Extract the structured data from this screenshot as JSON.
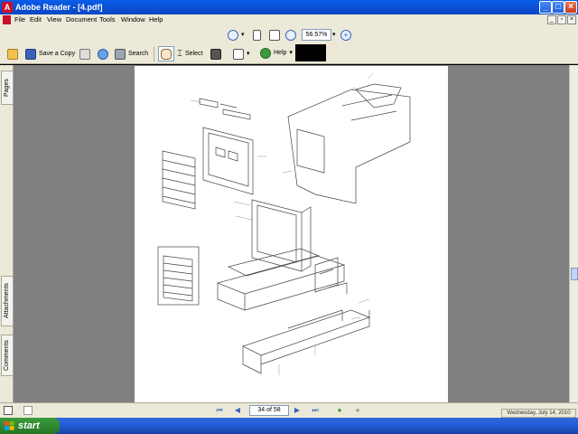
{
  "window": {
    "title": "Adobe Reader - [4.pdf]"
  },
  "menu": {
    "items": [
      "File",
      "Edit",
      "View",
      "Document",
      "Tools",
      "Window",
      "Help"
    ]
  },
  "toolbar": {
    "save_copy_label": "Save a Copy",
    "search_label": "Search",
    "select_label": "Select",
    "help_label": "Help",
    "zoom_value": "56.57%"
  },
  "nav_tabs": {
    "pages": "Pages",
    "attachments": "Attachments",
    "comments": "Comments"
  },
  "status": {
    "page_indicator": "34 of 58"
  },
  "taskbar": {
    "start_label": "start",
    "date": "Wednesday, July 14, 2010"
  },
  "colors": {
    "title_blue": "#0b4fd4",
    "chrome": "#ece9d8",
    "doc_bg": "#808080",
    "start_green": "#2f8a2f"
  }
}
